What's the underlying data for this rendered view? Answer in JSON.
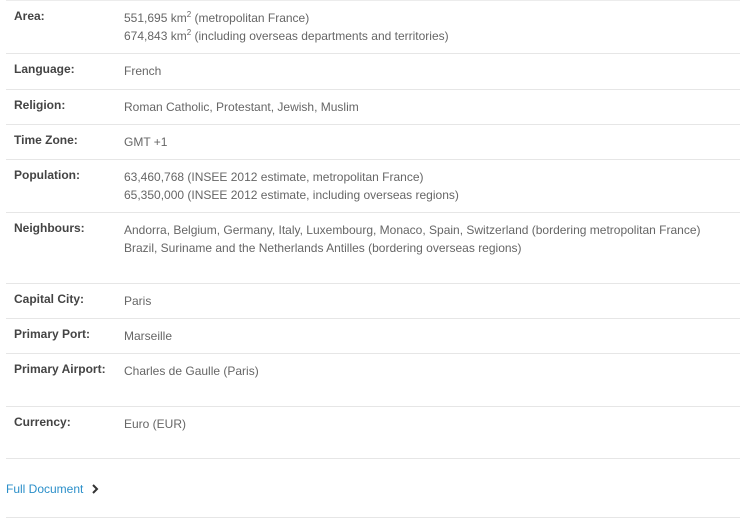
{
  "facts": {
    "area": {
      "label": "Area:",
      "line1_num": "551,695 km",
      "line1_sup": "2",
      "line1_rest": " (metropolitan France)",
      "line2_num": "674,843 km",
      "line2_sup": "2",
      "line2_rest": " (including overseas departments and territories)"
    },
    "language": {
      "label": "Language:",
      "value": "French"
    },
    "religion": {
      "label": "Religion:",
      "value": "Roman Catholic, Protestant, Jewish, Muslim"
    },
    "time_zone": {
      "label": "Time Zone:",
      "value": "GMT +1"
    },
    "population": {
      "label": "Population:",
      "line1": "63,460,768 (INSEE 2012 estimate, metropolitan France)",
      "line2": "65,350,000 (INSEE 2012 estimate, including overseas regions)"
    },
    "neighbours": {
      "label": "Neighbours:",
      "line1": "Andorra, Belgium, Germany, Italy, Luxembourg, Monaco, Spain, Switzerland (bordering metropolitan France)",
      "line2": "Brazil, Suriname and the Netherlands Antilles (bordering overseas regions)"
    },
    "capital_city": {
      "label": "Capital City:",
      "value": "Paris"
    },
    "primary_port": {
      "label": "Primary Port:",
      "value": "Marseille"
    },
    "primary_airport": {
      "label": "Primary Airport:",
      "value": "Charles de Gaulle (Paris)"
    },
    "currency": {
      "label": "Currency:",
      "value": "Euro (EUR)"
    }
  },
  "footer": {
    "link_label": "Full Document",
    "link_color": "#2b8fc9",
    "icon": "chevron-right-icon"
  }
}
